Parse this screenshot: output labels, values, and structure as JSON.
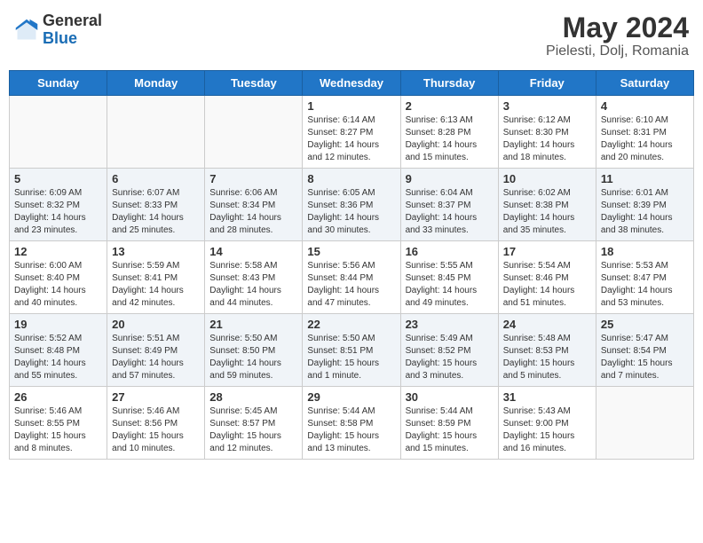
{
  "header": {
    "logo_general": "General",
    "logo_blue": "Blue",
    "month_year": "May 2024",
    "location": "Pielesti, Dolj, Romania"
  },
  "days_of_week": [
    "Sunday",
    "Monday",
    "Tuesday",
    "Wednesday",
    "Thursday",
    "Friday",
    "Saturday"
  ],
  "weeks": [
    [
      {
        "day": "",
        "content": ""
      },
      {
        "day": "",
        "content": ""
      },
      {
        "day": "",
        "content": ""
      },
      {
        "day": "1",
        "content": "Sunrise: 6:14 AM\nSunset: 8:27 PM\nDaylight: 14 hours\nand 12 minutes."
      },
      {
        "day": "2",
        "content": "Sunrise: 6:13 AM\nSunset: 8:28 PM\nDaylight: 14 hours\nand 15 minutes."
      },
      {
        "day": "3",
        "content": "Sunrise: 6:12 AM\nSunset: 8:30 PM\nDaylight: 14 hours\nand 18 minutes."
      },
      {
        "day": "4",
        "content": "Sunrise: 6:10 AM\nSunset: 8:31 PM\nDaylight: 14 hours\nand 20 minutes."
      }
    ],
    [
      {
        "day": "5",
        "content": "Sunrise: 6:09 AM\nSunset: 8:32 PM\nDaylight: 14 hours\nand 23 minutes."
      },
      {
        "day": "6",
        "content": "Sunrise: 6:07 AM\nSunset: 8:33 PM\nDaylight: 14 hours\nand 25 minutes."
      },
      {
        "day": "7",
        "content": "Sunrise: 6:06 AM\nSunset: 8:34 PM\nDaylight: 14 hours\nand 28 minutes."
      },
      {
        "day": "8",
        "content": "Sunrise: 6:05 AM\nSunset: 8:36 PM\nDaylight: 14 hours\nand 30 minutes."
      },
      {
        "day": "9",
        "content": "Sunrise: 6:04 AM\nSunset: 8:37 PM\nDaylight: 14 hours\nand 33 minutes."
      },
      {
        "day": "10",
        "content": "Sunrise: 6:02 AM\nSunset: 8:38 PM\nDaylight: 14 hours\nand 35 minutes."
      },
      {
        "day": "11",
        "content": "Sunrise: 6:01 AM\nSunset: 8:39 PM\nDaylight: 14 hours\nand 38 minutes."
      }
    ],
    [
      {
        "day": "12",
        "content": "Sunrise: 6:00 AM\nSunset: 8:40 PM\nDaylight: 14 hours\nand 40 minutes."
      },
      {
        "day": "13",
        "content": "Sunrise: 5:59 AM\nSunset: 8:41 PM\nDaylight: 14 hours\nand 42 minutes."
      },
      {
        "day": "14",
        "content": "Sunrise: 5:58 AM\nSunset: 8:43 PM\nDaylight: 14 hours\nand 44 minutes."
      },
      {
        "day": "15",
        "content": "Sunrise: 5:56 AM\nSunset: 8:44 PM\nDaylight: 14 hours\nand 47 minutes."
      },
      {
        "day": "16",
        "content": "Sunrise: 5:55 AM\nSunset: 8:45 PM\nDaylight: 14 hours\nand 49 minutes."
      },
      {
        "day": "17",
        "content": "Sunrise: 5:54 AM\nSunset: 8:46 PM\nDaylight: 14 hours\nand 51 minutes."
      },
      {
        "day": "18",
        "content": "Sunrise: 5:53 AM\nSunset: 8:47 PM\nDaylight: 14 hours\nand 53 minutes."
      }
    ],
    [
      {
        "day": "19",
        "content": "Sunrise: 5:52 AM\nSunset: 8:48 PM\nDaylight: 14 hours\nand 55 minutes."
      },
      {
        "day": "20",
        "content": "Sunrise: 5:51 AM\nSunset: 8:49 PM\nDaylight: 14 hours\nand 57 minutes."
      },
      {
        "day": "21",
        "content": "Sunrise: 5:50 AM\nSunset: 8:50 PM\nDaylight: 14 hours\nand 59 minutes."
      },
      {
        "day": "22",
        "content": "Sunrise: 5:50 AM\nSunset: 8:51 PM\nDaylight: 15 hours\nand 1 minute."
      },
      {
        "day": "23",
        "content": "Sunrise: 5:49 AM\nSunset: 8:52 PM\nDaylight: 15 hours\nand 3 minutes."
      },
      {
        "day": "24",
        "content": "Sunrise: 5:48 AM\nSunset: 8:53 PM\nDaylight: 15 hours\nand 5 minutes."
      },
      {
        "day": "25",
        "content": "Sunrise: 5:47 AM\nSunset: 8:54 PM\nDaylight: 15 hours\nand 7 minutes."
      }
    ],
    [
      {
        "day": "26",
        "content": "Sunrise: 5:46 AM\nSunset: 8:55 PM\nDaylight: 15 hours\nand 8 minutes."
      },
      {
        "day": "27",
        "content": "Sunrise: 5:46 AM\nSunset: 8:56 PM\nDaylight: 15 hours\nand 10 minutes."
      },
      {
        "day": "28",
        "content": "Sunrise: 5:45 AM\nSunset: 8:57 PM\nDaylight: 15 hours\nand 12 minutes."
      },
      {
        "day": "29",
        "content": "Sunrise: 5:44 AM\nSunset: 8:58 PM\nDaylight: 15 hours\nand 13 minutes."
      },
      {
        "day": "30",
        "content": "Sunrise: 5:44 AM\nSunset: 8:59 PM\nDaylight: 15 hours\nand 15 minutes."
      },
      {
        "day": "31",
        "content": "Sunrise: 5:43 AM\nSunset: 9:00 PM\nDaylight: 15 hours\nand 16 minutes."
      },
      {
        "day": "",
        "content": ""
      }
    ]
  ]
}
